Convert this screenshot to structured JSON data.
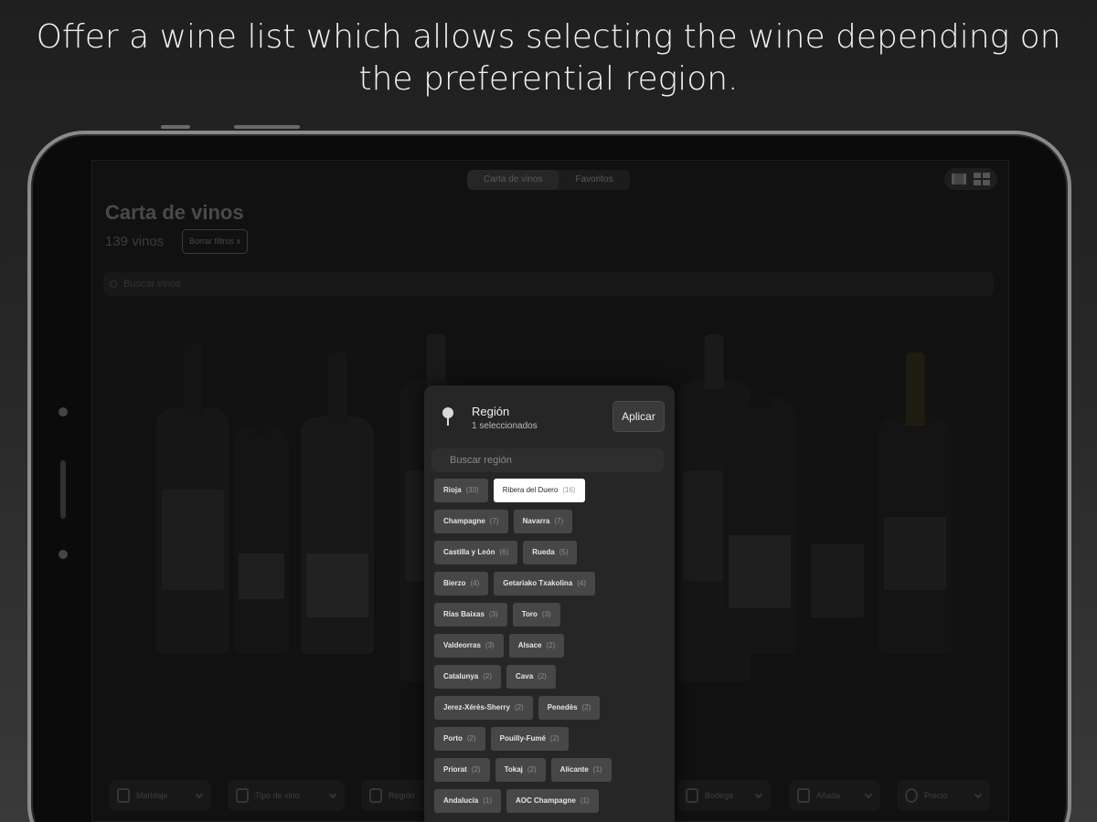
{
  "headline": {
    "line1": "Offer a wine list which allows selecting the wine depending on",
    "line2": "the preferential region."
  },
  "app": {
    "segments": [
      "Carta de vinos",
      "Favoritos"
    ],
    "active_segment": "Carta de vinos",
    "title": "Carta de vinos",
    "count": "139 vinos",
    "clear_filters": "Borrar filtros x",
    "search_placeholder": "Buscar vinos",
    "view_toggle_icons": [
      "carousel-view-icon",
      "grid-view-icon"
    ]
  },
  "region_popover": {
    "title": "Región",
    "subtitle": "1 seleccionados",
    "apply": "Aplicar",
    "search_placeholder": "Buscar región",
    "regions": [
      {
        "name": "Rioja",
        "count": "(33)",
        "selected": false
      },
      {
        "name": "Ribera del Duero",
        "count": "(16)",
        "selected": true
      },
      {
        "name": "Champagne",
        "count": "(7)",
        "selected": false
      },
      {
        "name": "Navarra",
        "count": "(7)",
        "selected": false
      },
      {
        "name": "Castilla y León",
        "count": "(6)",
        "selected": false
      },
      {
        "name": "Rueda",
        "count": "(5)",
        "selected": false
      },
      {
        "name": "Bierzo",
        "count": "(4)",
        "selected": false
      },
      {
        "name": "Getariako Txakolina",
        "count": "(4)",
        "selected": false
      },
      {
        "name": "Rías Baixas",
        "count": "(3)",
        "selected": false
      },
      {
        "name": "Toro",
        "count": "(3)",
        "selected": false
      },
      {
        "name": "Valdeorras",
        "count": "(3)",
        "selected": false
      },
      {
        "name": "Alsace",
        "count": "(2)",
        "selected": false
      },
      {
        "name": "Catalunya",
        "count": "(2)",
        "selected": false
      },
      {
        "name": "Cava",
        "count": "(2)",
        "selected": false
      },
      {
        "name": "Jerez-Xérès-Sherry",
        "count": "(2)",
        "selected": false
      },
      {
        "name": "Penedès",
        "count": "(2)",
        "selected": false
      },
      {
        "name": "Porto",
        "count": "(2)",
        "selected": false
      },
      {
        "name": "Pouilly-Fumé",
        "count": "(2)",
        "selected": false
      },
      {
        "name": "Priorat",
        "count": "(2)",
        "selected": false
      },
      {
        "name": "Tokaj",
        "count": "(2)",
        "selected": false
      },
      {
        "name": "Alicante",
        "count": "(1)",
        "selected": false
      },
      {
        "name": "Andalucía",
        "count": "(1)",
        "selected": false
      },
      {
        "name": "AOC Champagne",
        "count": "(1)",
        "selected": false
      }
    ]
  },
  "filters": [
    {
      "label": "Maridaje",
      "icon": "cutlery-icon"
    },
    {
      "label": "Tipo de vino",
      "icon": "wine-glass-icon"
    },
    {
      "label": "Región",
      "icon": "pin-icon"
    },
    {
      "label": "Bodega",
      "icon": "building-icon"
    },
    {
      "label": "Añada",
      "icon": "calendar-icon"
    },
    {
      "label": "Precio",
      "icon": "euro-icon"
    }
  ],
  "colors": {
    "background": "#222222",
    "popover": "#262626",
    "chip": "#474747",
    "chip_selected": "#ffffff"
  }
}
